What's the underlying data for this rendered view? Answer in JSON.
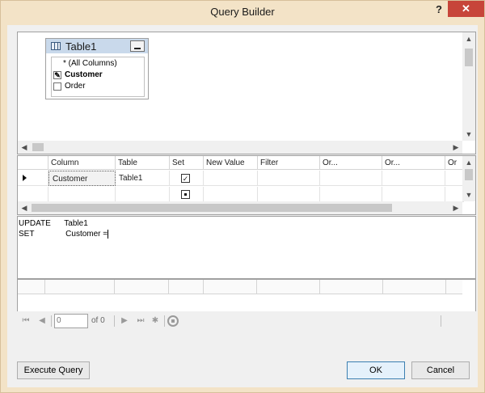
{
  "window": {
    "title": "Query Builder",
    "help": "?",
    "close": "✕"
  },
  "diagram": {
    "table": {
      "name": "Table1",
      "columns": [
        {
          "label": "* (All Columns)",
          "state": ""
        },
        {
          "label": "Customer",
          "state": "✎"
        },
        {
          "label": "Order",
          "state": ""
        }
      ]
    }
  },
  "grid": {
    "headers": [
      "Column",
      "Table",
      "Set",
      "New Value",
      "Filter",
      "Or...",
      "Or...",
      "Or"
    ],
    "rows": [
      {
        "column": "Customer",
        "table": "Table1",
        "set": "✓"
      },
      {
        "column": "",
        "table": "",
        "set": ""
      }
    ]
  },
  "sql": {
    "line1": "UPDATE      Table1",
    "line2": "SET              Customer ="
  },
  "navigator": {
    "position": "0",
    "of": "of 0"
  },
  "buttons": {
    "execute": "Execute Query",
    "ok": "OK",
    "cancel": "Cancel"
  },
  "icons": {
    "up": "▲",
    "down": "▼",
    "left": "◀",
    "right": "▶",
    "first": "⏮",
    "prev": "◀",
    "next": "▶",
    "last": "⏭",
    "new": "✱"
  }
}
